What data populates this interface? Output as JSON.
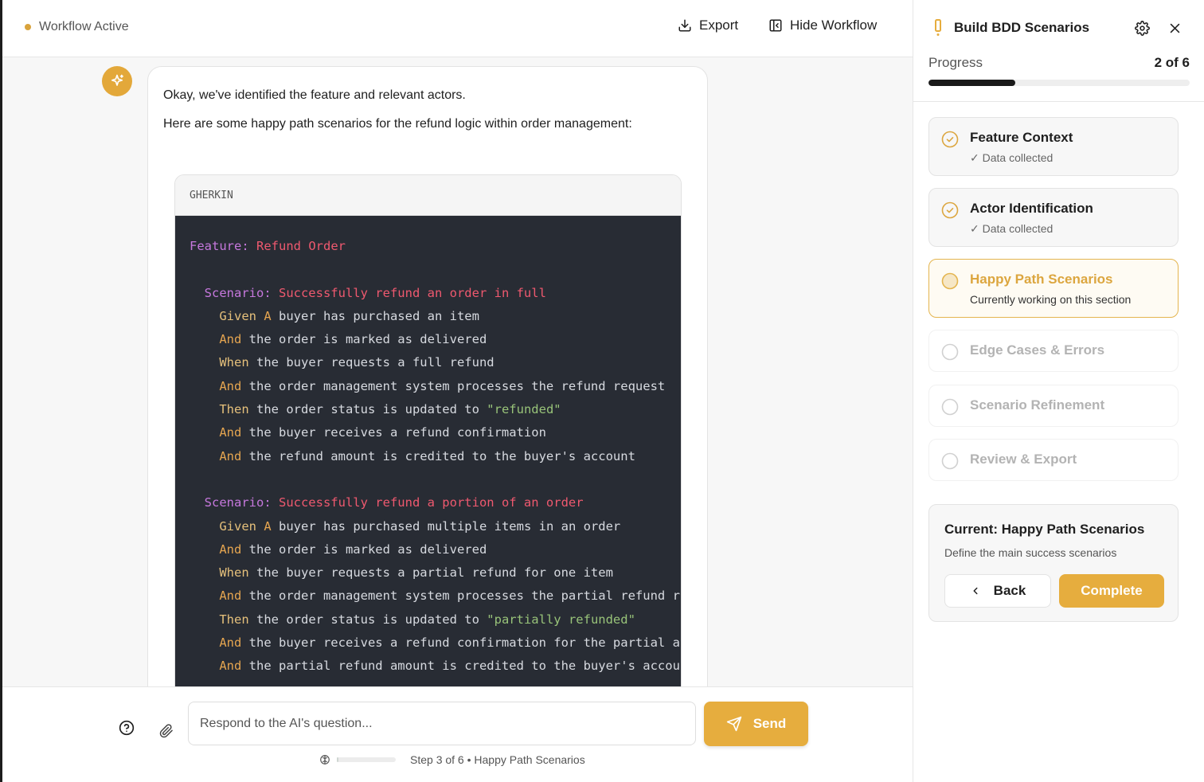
{
  "header": {
    "status_text": "Workflow Active",
    "export_label": "Export",
    "hide_workflow_label": "Hide Workflow"
  },
  "message": {
    "line1": "Okay, we've identified the feature and relevant actors.",
    "line2": "Here are some happy path scenarios for the refund logic within order management:",
    "code_language": "GHERKIN",
    "code_lines": [
      [
        {
          "t": "Feature: ",
          "c": "kw"
        },
        {
          "t": "Refund Order",
          "c": "nm"
        }
      ],
      [],
      [
        {
          "t": "  Scenario: ",
          "c": "kw"
        },
        {
          "t": "Successfully refund an order in full",
          "c": "nm"
        }
      ],
      [
        {
          "t": "    Given ",
          "c": "st"
        },
        {
          "t": "A ",
          "c": "sa"
        },
        {
          "t": "buyer has purchased an item",
          "c": ""
        }
      ],
      [
        {
          "t": "    And ",
          "c": "sa"
        },
        {
          "t": "the order is marked as delivered",
          "c": ""
        }
      ],
      [
        {
          "t": "    When ",
          "c": "st"
        },
        {
          "t": "the buyer requests a full refund",
          "c": ""
        }
      ],
      [
        {
          "t": "    And ",
          "c": "sa"
        },
        {
          "t": "the order management system processes the refund request",
          "c": ""
        }
      ],
      [
        {
          "t": "    Then ",
          "c": "st"
        },
        {
          "t": "the order status is updated to ",
          "c": ""
        },
        {
          "t": "\"refunded\"",
          "c": "str"
        }
      ],
      [
        {
          "t": "    And ",
          "c": "sa"
        },
        {
          "t": "the buyer receives a refund confirmation",
          "c": ""
        }
      ],
      [
        {
          "t": "    And ",
          "c": "sa"
        },
        {
          "t": "the refund amount is credited to the buyer's account",
          "c": ""
        }
      ],
      [],
      [
        {
          "t": "  Scenario: ",
          "c": "kw"
        },
        {
          "t": "Successfully refund a portion of an order",
          "c": "nm"
        }
      ],
      [
        {
          "t": "    Given ",
          "c": "st"
        },
        {
          "t": "A ",
          "c": "sa"
        },
        {
          "t": "buyer has purchased multiple items in an order",
          "c": ""
        }
      ],
      [
        {
          "t": "    And ",
          "c": "sa"
        },
        {
          "t": "the order is marked as delivered",
          "c": ""
        }
      ],
      [
        {
          "t": "    When ",
          "c": "st"
        },
        {
          "t": "the buyer requests a partial refund for one item",
          "c": ""
        }
      ],
      [
        {
          "t": "    And ",
          "c": "sa"
        },
        {
          "t": "the order management system processes the partial refund r",
          "c": ""
        }
      ],
      [
        {
          "t": "    Then ",
          "c": "st"
        },
        {
          "t": "the order status is updated to ",
          "c": ""
        },
        {
          "t": "\"partially refunded\"",
          "c": "str"
        }
      ],
      [
        {
          "t": "    And ",
          "c": "sa"
        },
        {
          "t": "the buyer receives a refund confirmation for the partial a",
          "c": ""
        }
      ],
      [
        {
          "t": "    And ",
          "c": "sa"
        },
        {
          "t": "the partial refund amount is credited to the buyer's accou",
          "c": ""
        }
      ]
    ]
  },
  "composer": {
    "placeholder": "Respond to the AI's question...",
    "send_label": "Send",
    "step_text": "Step 3 of 6 • Happy Path Scenarios",
    "mini_progress": 0.03
  },
  "sidebar": {
    "title": "Build BDD Scenarios",
    "progress_label": "Progress",
    "progress_count": "2 of 6",
    "progress_fraction": 0.3333,
    "steps": [
      {
        "title": "Feature Context",
        "subtitle": "✓ Data collected",
        "state": "done"
      },
      {
        "title": "Actor Identification",
        "subtitle": "✓ Data collected",
        "state": "done"
      },
      {
        "title": "Happy Path Scenarios",
        "subtitle": "Currently working on this section",
        "state": "current"
      },
      {
        "title": "Edge Cases & Errors",
        "subtitle": "",
        "state": "pending"
      },
      {
        "title": "Scenario Refinement",
        "subtitle": "",
        "state": "pending"
      },
      {
        "title": "Review & Export",
        "subtitle": "",
        "state": "pending"
      }
    ],
    "current": {
      "title": "Current: Happy Path Scenarios",
      "description": "Define the main success scenarios",
      "back_label": "Back",
      "complete_label": "Complete"
    }
  },
  "colors": {
    "accent": "#e6ad3e",
    "code_bg": "#282c34",
    "progress_fill": "#1a1a1a"
  }
}
